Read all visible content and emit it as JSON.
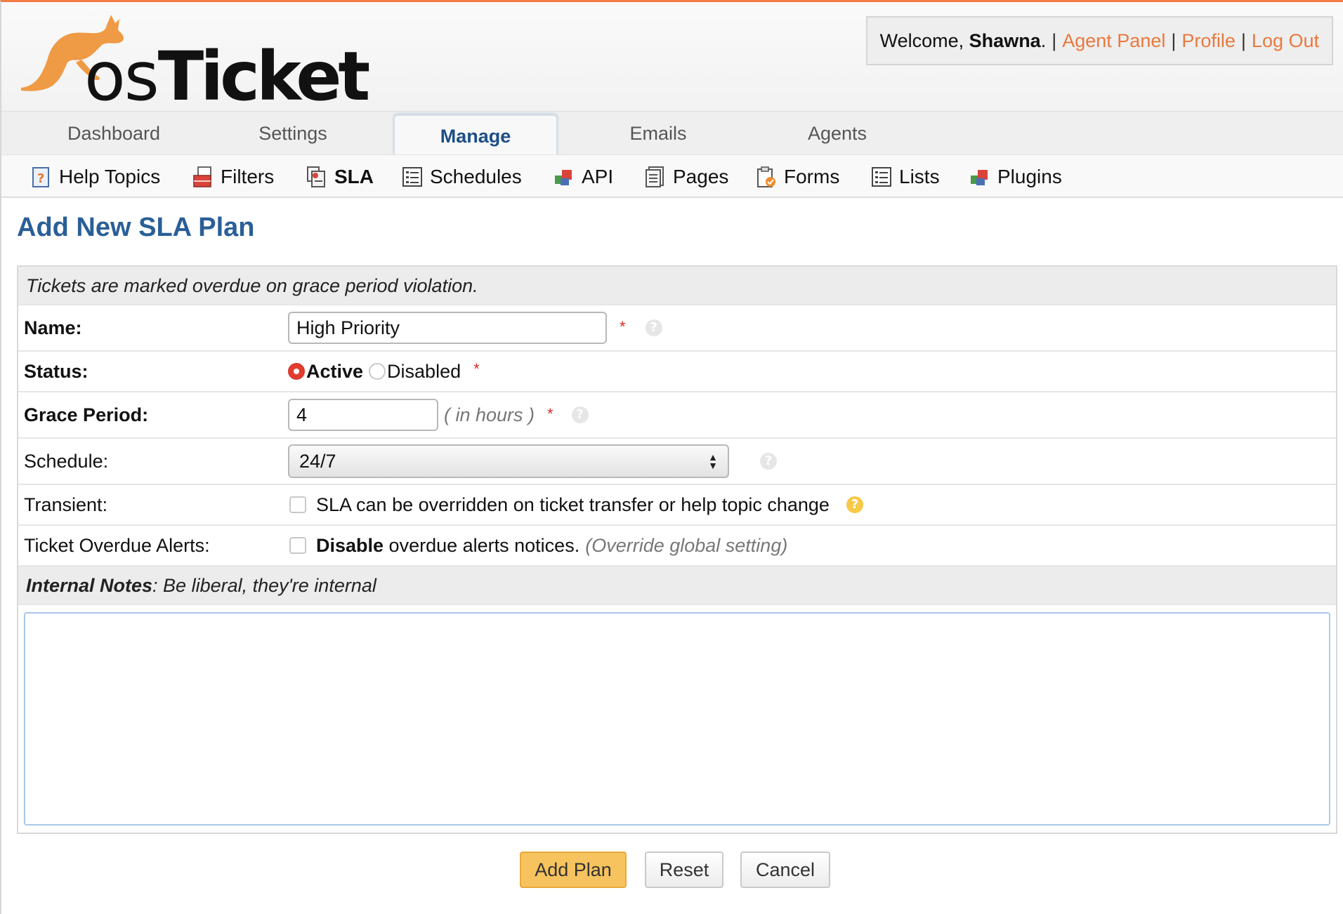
{
  "brand": {
    "logo_os": "os",
    "logo_ticket": "Ticket",
    "accent_color": "#f07b46",
    "title_color": "#2a5f97"
  },
  "user": {
    "welcome_prefix": "Welcome, ",
    "name": "Shawna",
    "name_suffix": ".",
    "separator": "|",
    "agent_panel": "Agent Panel",
    "profile": "Profile",
    "logout": "Log Out"
  },
  "topnav": {
    "tabs": [
      {
        "label": "Dashboard"
      },
      {
        "label": "Settings"
      },
      {
        "label": "Manage",
        "active": true
      },
      {
        "label": "Emails"
      },
      {
        "label": "Agents"
      }
    ]
  },
  "subnav": {
    "items": [
      {
        "label": "Help Topics",
        "icon": "help-topics-icon"
      },
      {
        "label": "Filters",
        "icon": "filters-icon"
      },
      {
        "label": "SLA",
        "icon": "sla-icon",
        "active": true
      },
      {
        "label": "Schedules",
        "icon": "schedules-icon"
      },
      {
        "label": "API",
        "icon": "api-icon"
      },
      {
        "label": "Pages",
        "icon": "pages-icon"
      },
      {
        "label": "Forms",
        "icon": "forms-icon"
      },
      {
        "label": "Lists",
        "icon": "lists-icon"
      },
      {
        "label": "Plugins",
        "icon": "plugins-icon"
      }
    ]
  },
  "page": {
    "title": "Add New SLA Plan",
    "intro": "Tickets are marked overdue on grace period violation."
  },
  "form": {
    "name": {
      "label": "Name:",
      "value": "High Priority",
      "required": "*"
    },
    "status": {
      "label": "Status:",
      "options": [
        "Active",
        "Disabled"
      ],
      "selected": "Active",
      "required": "*"
    },
    "grace_period": {
      "label": "Grace Period:",
      "value": "4",
      "hint": "( in hours )",
      "required": "*"
    },
    "schedule": {
      "label": "Schedule:",
      "value": "24/7"
    },
    "transient": {
      "label": "Transient:",
      "text": "SLA can be overridden on ticket transfer or help topic change",
      "checked": false
    },
    "overdue_alerts": {
      "label": "Ticket Overdue Alerts:",
      "bold": "Disable",
      "text": " overdue alerts notices.",
      "note": "(Override global setting)",
      "checked": false
    },
    "notes": {
      "label": "Internal Notes",
      "hint": ": Be liberal, they're internal",
      "value": ""
    }
  },
  "buttons": {
    "submit": "Add Plan",
    "reset": "Reset",
    "cancel": "Cancel"
  }
}
